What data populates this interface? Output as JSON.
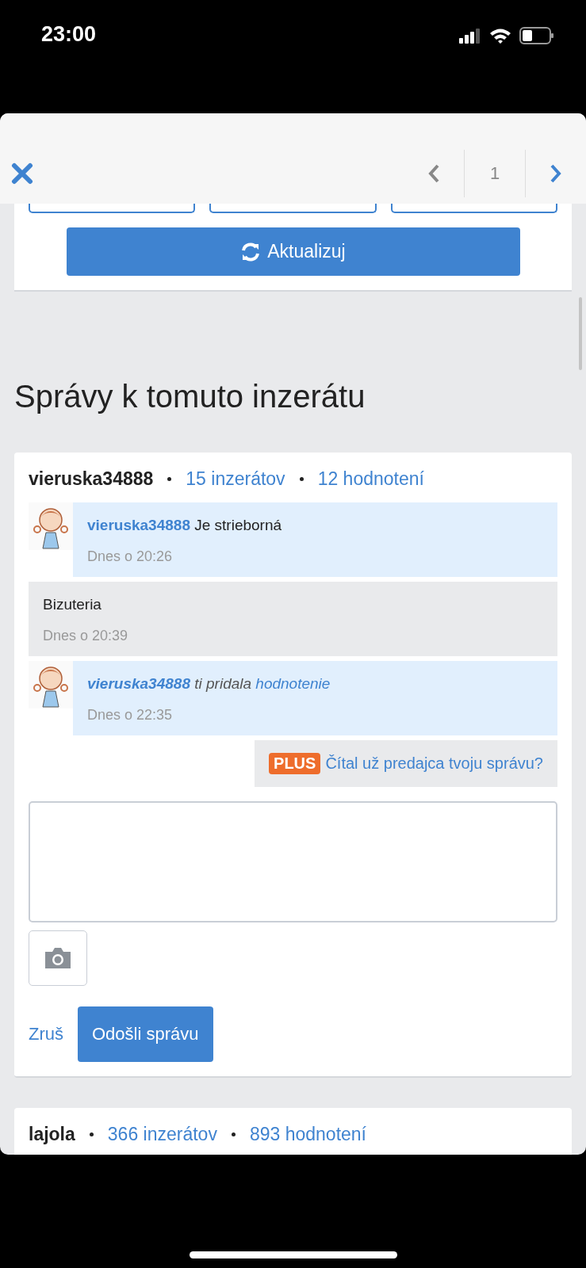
{
  "status_bar": {
    "time": "23:00"
  },
  "header": {
    "page": "1"
  },
  "refresh_button": {
    "label": "Aktualizuj"
  },
  "heading": "Správy k tomuto inzerátu",
  "conversations": [
    {
      "user": "vieruska34888",
      "listings": "15 inzerátov",
      "ratings": "12 hodnotení",
      "messages": [
        {
          "kind": "incoming",
          "author": "vieruska34888",
          "text": "Je strieborná",
          "time": "Dnes o 20:26"
        },
        {
          "kind": "outgoing",
          "text": "Bizuteria",
          "time": "Dnes o 20:39"
        },
        {
          "kind": "rating",
          "author": "vieruska34888",
          "text": "ti pridala",
          "link": "hodnotenie",
          "time": "Dnes o 22:35"
        }
      ],
      "plus_notice": {
        "badge": "PLUS",
        "text": "Čítal už predajca tvoju správu?"
      },
      "compose": {
        "cancel": "Zruš",
        "send": "Odošli správu"
      }
    },
    {
      "user": "lajola",
      "listings": "366 inzerátov",
      "ratings": "893 hodnotení"
    }
  ]
}
